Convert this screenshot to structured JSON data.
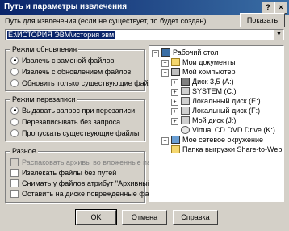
{
  "window": {
    "title": "Путь и параметры извлечения"
  },
  "path": {
    "label": "Путь для извлечения (если не существует, то будет создан)",
    "value": "E:\\ИСТОРИЯ ЭВМ\\история эвм",
    "show_button": "Показать"
  },
  "update_mode": {
    "title": "Режим обновления",
    "options": [
      "Извлечь с заменой файлов",
      "Извлечь с обновлением файлов",
      "Обновить только существующие файлы"
    ],
    "selected": 0
  },
  "overwrite_mode": {
    "title": "Режим перезаписи",
    "options": [
      "Выдавать запрос при перезаписи",
      "Перезаписывать без запроса",
      "Пропускать существующие файлы"
    ],
    "selected": 0
  },
  "misc": {
    "title": "Разное",
    "options": [
      {
        "label": "Распаковать архивы во вложенные папки",
        "checked": false,
        "disabled": true
      },
      {
        "label": "Извлекать файлы без путей",
        "checked": false,
        "disabled": false
      },
      {
        "label": "Снимать у файлов атрибут \"Архивный\"",
        "checked": false,
        "disabled": false
      },
      {
        "label": "Оставить на диске поврежденные файлы",
        "checked": false,
        "disabled": false
      }
    ]
  },
  "tree": {
    "nodes": [
      {
        "label": "Рабочий стол",
        "icon": "desktop-icon"
      },
      {
        "label": "Мои документы",
        "icon": "folder-icon"
      },
      {
        "label": "Мой компьютер",
        "icon": "computer-icon"
      },
      {
        "label": "Диск 3,5 (A:)",
        "icon": "floppy-icon"
      },
      {
        "label": "SYSTEM (C:)",
        "icon": "drive-icon"
      },
      {
        "label": "Локальный диск (E:)",
        "icon": "drive-icon"
      },
      {
        "label": "Локальный диск (F:)",
        "icon": "drive-icon"
      },
      {
        "label": "Мой диск (J:)",
        "icon": "drive-icon"
      },
      {
        "label": "Virtual CD DVD Drive (K:)",
        "icon": "cd-icon"
      },
      {
        "label": "Мое сетевое окружение",
        "icon": "network-icon"
      },
      {
        "label": "Папка выгрузки Share-to-Web",
        "icon": "folder-icon"
      }
    ]
  },
  "buttons": {
    "ok": "OK",
    "cancel": "Отмена",
    "help": "Справка"
  },
  "colors": {
    "titlebar_start": "#0a246a",
    "titlebar_end": "#3a6ea5",
    "window_bg": "#d4d0c8",
    "selection": "#0a246a"
  }
}
